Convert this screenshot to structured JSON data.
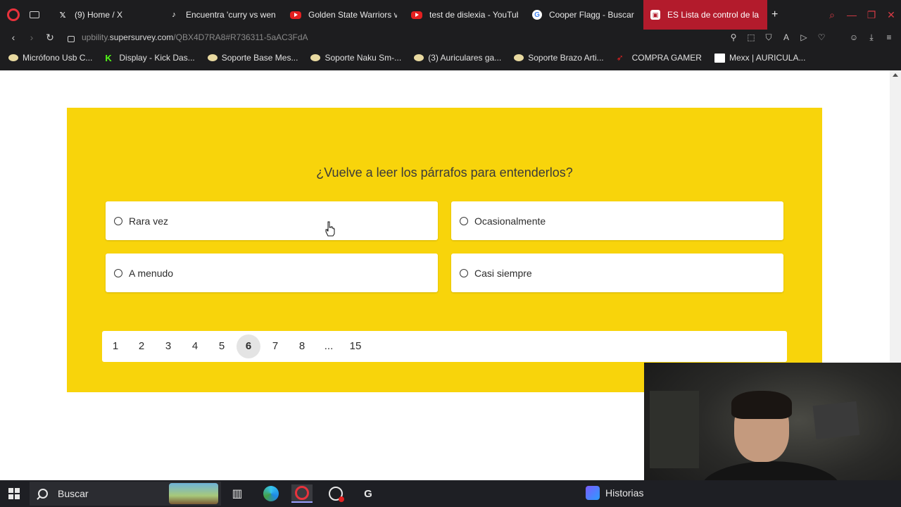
{
  "browser": {
    "tabs": [
      {
        "title": "(9) Home / X",
        "icon": "x-logo-icon",
        "active": false
      },
      {
        "title": "Encuentra 'curry vs wen",
        "icon": "tiktok-icon",
        "active": false
      },
      {
        "title": "Golden State Warriors v",
        "icon": "youtube-icon",
        "active": false
      },
      {
        "title": "test de dislexia - YouTub",
        "icon": "youtube-icon",
        "active": false
      },
      {
        "title": "Cooper Flagg - Buscar c",
        "icon": "google-icon",
        "active": false
      },
      {
        "title": "ES Lista de control de la d",
        "icon": "supersurvey-icon",
        "active": true
      }
    ],
    "address": {
      "prefix": "upbility.",
      "host": "supersurvey.com",
      "path": "/QBX4D7RA8#R736311-5aAC3FdA"
    },
    "bookmarks": [
      {
        "label": "Micrófono Usb C...",
        "icon": "bookmark-icon"
      },
      {
        "label": "Display - Kick Das...",
        "icon": "kick-icon"
      },
      {
        "label": "Soporte Base Mes...",
        "icon": "bookmark-icon"
      },
      {
        "label": "Soporte Naku Sm-...",
        "icon": "bookmark-icon"
      },
      {
        "label": "(3) Auriculares ga...",
        "icon": "bookmark-icon"
      },
      {
        "label": "Soporte Brazo Arti...",
        "icon": "bookmark-icon"
      },
      {
        "label": "COMPRA GAMER",
        "icon": "compra-gamer-icon"
      },
      {
        "label": "Mexx | AURICULA...",
        "icon": "mexx-icon"
      }
    ]
  },
  "survey": {
    "question": "¿Vuelve a leer los párrafos para entenderlos?",
    "options": [
      "Rara vez",
      "Ocasionalmente",
      "A menudo",
      "Casi siempre"
    ],
    "pages": [
      "1",
      "2",
      "3",
      "4",
      "5",
      "6",
      "7",
      "8",
      "...",
      "15"
    ],
    "current_page": "6",
    "accent_color": "#f8d40b"
  },
  "taskbar": {
    "search_label": "Buscar",
    "historias_label": "Historias"
  }
}
